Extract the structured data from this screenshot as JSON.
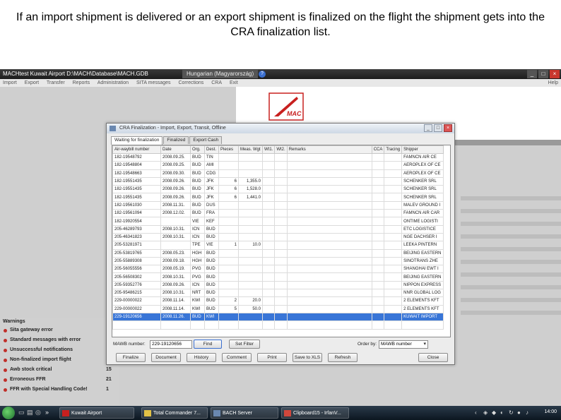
{
  "slide": {
    "title": "If an import shipment is delivered or an export shipment is finalized on the flight the shipment gets into the CRA finalization list."
  },
  "app": {
    "titlebar": "MACHtest   Kuwait Airport   D:\\MACH\\Database\\MACH.GDB",
    "language": "Hungarian (Magyarország)",
    "help_badge": "?",
    "controls": {
      "minimize": "_",
      "maximize": "□",
      "close": "×"
    },
    "menu": [
      "Import",
      "Export",
      "Transfer",
      "Reports",
      "Administration",
      "SITA messages",
      "Corrections",
      "CRA",
      "Exit"
    ],
    "menu_help": "Help",
    "logo_text": "MAC",
    "brand_color": "#c8201f"
  },
  "warnings": {
    "header": "Warnings",
    "items": [
      {
        "label": "Sita gateway error",
        "count": ""
      },
      {
        "label": "Standard messages with error",
        "count": ""
      },
      {
        "label": "Unsuccessful notifications",
        "count": ""
      },
      {
        "label": "Non-finalized import flight",
        "count": ""
      },
      {
        "label": "Awb stock critical",
        "count": "15"
      },
      {
        "label": "Erroneous FFR",
        "count": "21"
      },
      {
        "label": "FFR with Special Handling Code!",
        "count": "1"
      }
    ]
  },
  "dialog": {
    "title": "CRA Finalization - Import, Export, Transit, Offline",
    "tabs": [
      "Waiting for finalization",
      "Finalized",
      "Export Cash"
    ],
    "columns": [
      "Air-waybill number",
      "Date",
      "Org.",
      "Dest.",
      "Pieces",
      "Meas. Wgt",
      "Wt1.",
      "Wt2.",
      "Remarks",
      "CCA",
      "Tracing",
      "Shipper"
    ],
    "rows": [
      [
        "182-19548792",
        "2008.09.25.",
        "BUD",
        "TIN",
        "",
        "",
        "",
        "",
        "",
        "",
        "",
        "FAMNCN AIR CE"
      ],
      [
        "182-19548804",
        "2008.09.25.",
        "BUD",
        "AMI",
        "",
        "",
        "",
        "",
        "",
        "",
        "",
        "AEROPLEX OF CE"
      ],
      [
        "182-19548663",
        "2008.09.30.",
        "BUD",
        "CDG",
        "",
        "",
        "",
        "",
        "",
        "",
        "",
        "AEROPLEX OF CE"
      ],
      [
        "182-19551435",
        "2008.09.26.",
        "BUD",
        "JFK",
        "6",
        "1,355.0",
        "",
        "",
        "",
        "",
        "",
        "SCHENKER SRL"
      ],
      [
        "182-19551435",
        "2008.09.26.",
        "BUD",
        "JFK",
        "6",
        "1,528.0",
        "",
        "",
        "",
        "",
        "",
        "SCHENKER SRL"
      ],
      [
        "182-19551435",
        "2008.09.26.",
        "BUD",
        "JFK",
        "6",
        "1,441.0",
        "",
        "",
        "",
        "",
        "",
        "SCHENKER SRL"
      ],
      [
        "182-19561030",
        "2008.11.31.",
        "BUD",
        "DUS",
        "",
        "",
        "",
        "",
        "",
        "",
        "",
        "MALEV GROUND I"
      ],
      [
        "182-19561094",
        "2008.12.02.",
        "BUD",
        "FRA",
        "",
        "",
        "",
        "",
        "",
        "",
        "",
        "FAMNCN AIR CAR"
      ],
      [
        "182-19920554",
        "",
        "VIE",
        "KEF",
        "",
        "",
        "",
        "",
        "",
        "",
        "",
        "ONTIME LOGISTI"
      ],
      [
        "205-46289793",
        "2008.10.31.",
        "ICN",
        "BUD",
        "",
        "",
        "",
        "",
        "",
        "",
        "",
        "ETC LOGISTICE"
      ],
      [
        "205-46341823",
        "2008.10.31.",
        "ICN",
        "BUD",
        "",
        "",
        "",
        "",
        "",
        "",
        "",
        "NGE DACHSER I"
      ],
      [
        "205-53281971",
        "",
        "TPE",
        "VIE",
        "1",
        "10.0",
        "",
        "",
        "",
        "",
        "",
        "LEEKA PINTERN"
      ],
      [
        "205-53819765",
        "2008.05.23.",
        "HGH",
        "BUD",
        "",
        "",
        "",
        "",
        "",
        "",
        "",
        "BEIJING EASTERN"
      ],
      [
        "205-55889308",
        "2008.09.18.",
        "HGH",
        "BUD",
        "",
        "",
        "",
        "",
        "",
        "",
        "",
        "SINOTRANS ZHE"
      ],
      [
        "205-56055556",
        "2008.05.19.",
        "PVG",
        "BUD",
        "",
        "",
        "",
        "",
        "",
        "",
        "",
        "SHANGHAI EWT I"
      ],
      [
        "205-56508302",
        "2008.10.31.",
        "PVG",
        "BUD",
        "",
        "",
        "",
        "",
        "",
        "",
        "",
        "BEIJING EASTERN"
      ],
      [
        "205-59352776",
        "2008.09.26.",
        "ICN",
        "BUD",
        "",
        "",
        "",
        "",
        "",
        "",
        "",
        "NIPPON EXPRESS"
      ],
      [
        "205-95486215",
        "2008.10.31.",
        "NRT",
        "BUD",
        "",
        "",
        "",
        "",
        "",
        "",
        "",
        "NNR GLOBAL LOG"
      ],
      [
        "229-00000022",
        "2008.11.14.",
        "KWI",
        "BUD",
        "2",
        "20.0",
        "",
        "",
        "",
        "",
        "",
        "2 ELEMENTS KFT"
      ],
      [
        "229-00000022",
        "2008.11.14.",
        "KWI",
        "BUD",
        "5",
        "50.0",
        "",
        "",
        "",
        "",
        "",
        "2 ELEMENTS KFT"
      ],
      [
        "229-19120656",
        "2008.11.26.",
        "BUD",
        "KWI",
        "",
        "",
        "",
        "",
        "",
        "",
        "",
        "KUWAIT IMPORT"
      ]
    ],
    "selected_row": 20,
    "mawb_label": "MAWB number:",
    "mawb_value": "229-19120656",
    "find_label": "Find",
    "set_filter_label": "Set Filter",
    "order_by_label": "Order by:",
    "order_by_value": "MAWB number",
    "buttons": {
      "finalize": "Finalize",
      "document": "Document",
      "history": "History",
      "comment": "Comment",
      "print": "Print",
      "save_xls": "Save to XLS",
      "refresh": "Refresh",
      "close": "Close"
    }
  },
  "taskbar": {
    "tasks": [
      "Kuwait Airport",
      "Total Commander 7...",
      "BACH Server",
      "Clipboard15 - IrfanV..."
    ],
    "clock": "14:00"
  }
}
